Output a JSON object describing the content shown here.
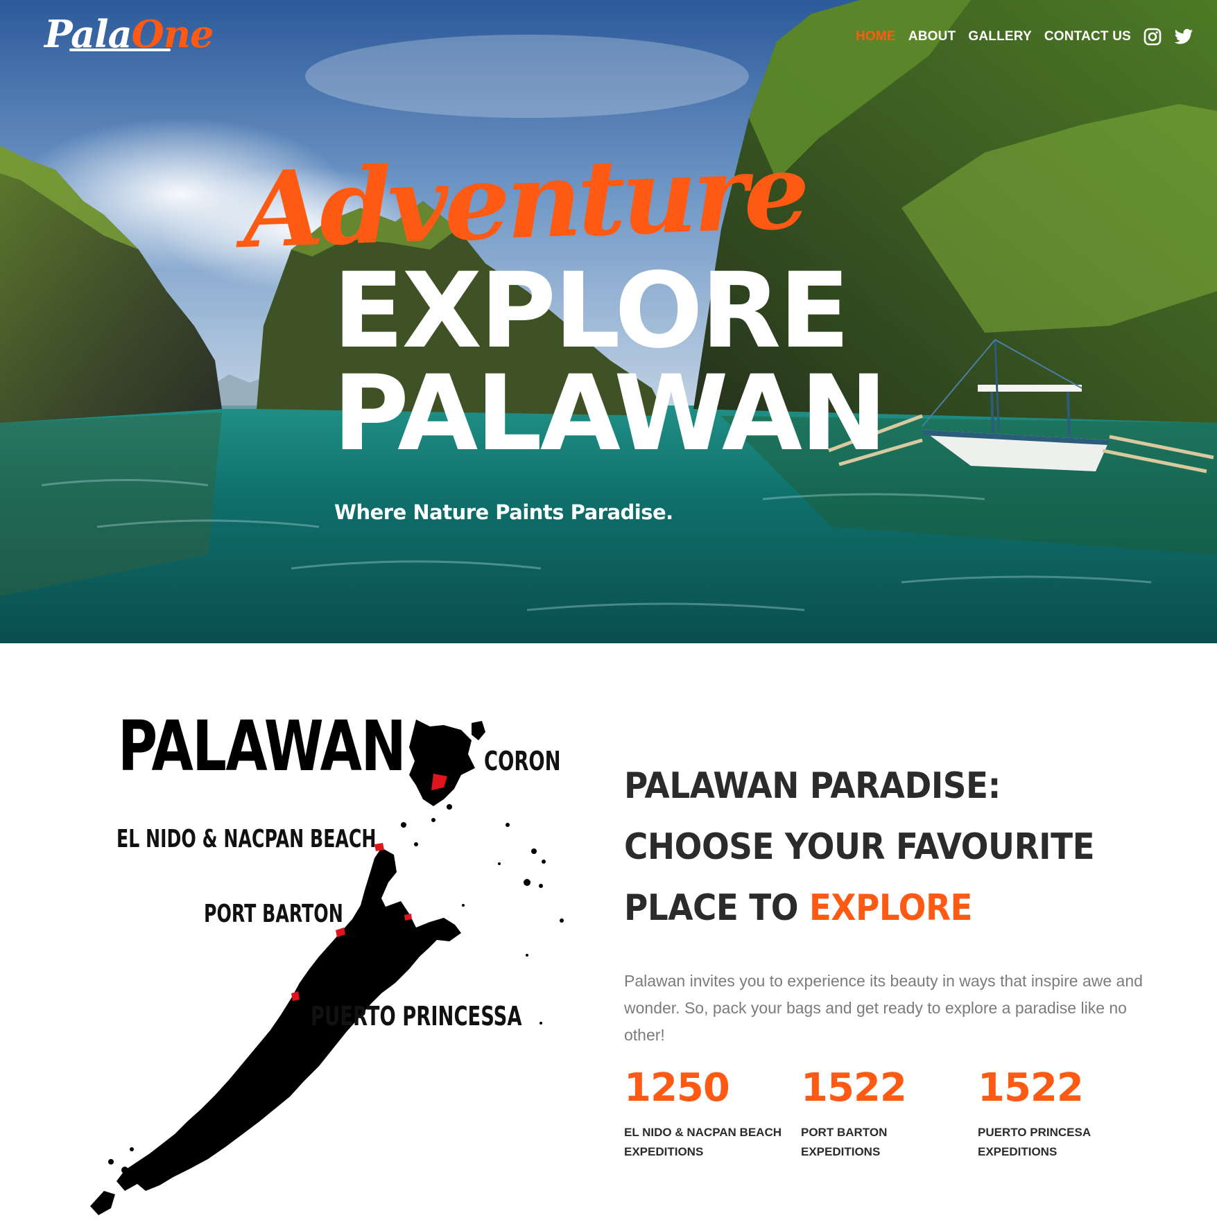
{
  "brand": {
    "logo_part1": "Pala",
    "logo_part2": "One"
  },
  "nav": {
    "items": [
      {
        "label": "HOME",
        "active": true
      },
      {
        "label": "ABOUT",
        "active": false
      },
      {
        "label": "GALLERY",
        "active": false
      },
      {
        "label": "CONTACT US",
        "active": false
      }
    ],
    "social": [
      "instagram-icon",
      "twitter-icon"
    ]
  },
  "hero": {
    "script_word": "Adventure",
    "title_line1": "EXPLORE",
    "title_line2": "PALAWAN",
    "tagline": "Where Nature Paints Paradise."
  },
  "map": {
    "title": "PALAWAN",
    "labels": {
      "coron": "CORON",
      "el_nido": "EL NIDO & NACPAN BEACH",
      "port_barton": "PORT BARTON",
      "puerto_princesa": "PUERTO PRINCESSA"
    }
  },
  "section": {
    "headline_line1": "PALAWAN PARADISE:",
    "headline_line2": "CHOOSE YOUR FAVOURITE",
    "headline_line3_prefix": "PLACE TO",
    "headline_line3_accent": "EXPLORE",
    "intro": "Palawan invites you to experience its beauty in ways that inspire awe and wonder. So, pack your bags and get ready to explore a paradise like no other!"
  },
  "stats": [
    {
      "value": "1250",
      "label_line1": "EL NIDO & NACPAN BEACH",
      "label_line2": "EXPEDITIONS"
    },
    {
      "value": "1522",
      "label_line1": "PORT BARTON",
      "label_line2": "EXPEDITIONS"
    },
    {
      "value": "1522",
      "label_line1": "PUERTO PRINCESA",
      "label_line2": "EXPEDITIONS"
    }
  ],
  "colors": {
    "accent": "#ff5a14",
    "heading": "#2b2b2b",
    "body_text": "#7b7b7b"
  }
}
